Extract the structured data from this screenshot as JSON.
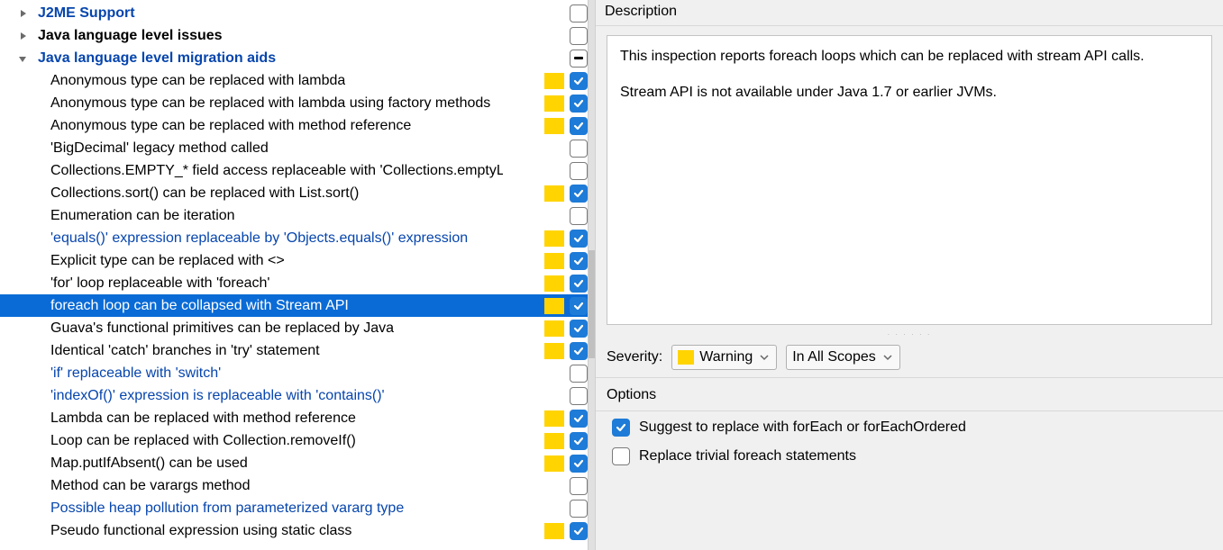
{
  "tree": {
    "groups": [
      {
        "label": "J2ME Support",
        "expanded": false,
        "bold": true,
        "link": true,
        "checkbox": "off"
      },
      {
        "label": "Java language level issues",
        "expanded": false,
        "bold": true,
        "link": false,
        "checkbox": "off"
      },
      {
        "label": "Java language level migration aids",
        "expanded": true,
        "bold": true,
        "link": true,
        "checkbox": "mixed"
      }
    ],
    "items": [
      {
        "label": "Anonymous type can be replaced with lambda",
        "link": false,
        "sev": true,
        "checkbox": "on",
        "selected": false
      },
      {
        "label": "Anonymous type can be replaced with lambda using factory methods",
        "link": false,
        "sev": true,
        "checkbox": "on",
        "selected": false
      },
      {
        "label": "Anonymous type can be replaced with method reference",
        "link": false,
        "sev": true,
        "checkbox": "on",
        "selected": false
      },
      {
        "label": "'BigDecimal' legacy method called",
        "link": false,
        "sev": false,
        "checkbox": "off",
        "selected": false
      },
      {
        "label": "Collections.EMPTY_* field access replaceable with 'Collections.emptyList()'",
        "link": false,
        "sev": false,
        "checkbox": "off",
        "selected": false
      },
      {
        "label": "Collections.sort() can be replaced with List.sort()",
        "link": false,
        "sev": true,
        "checkbox": "on",
        "selected": false
      },
      {
        "label": "Enumeration can be iteration",
        "link": false,
        "sev": false,
        "checkbox": "off",
        "selected": false
      },
      {
        "label": "'equals()' expression replaceable by 'Objects.equals()' expression",
        "link": true,
        "sev": true,
        "checkbox": "on",
        "selected": false
      },
      {
        "label": "Explicit type can be replaced with <>",
        "link": false,
        "sev": true,
        "checkbox": "on",
        "selected": false
      },
      {
        "label": "'for' loop replaceable with 'foreach'",
        "link": false,
        "sev": true,
        "checkbox": "on",
        "selected": false
      },
      {
        "label": "foreach loop can be collapsed with Stream API",
        "link": false,
        "sev": true,
        "checkbox": "on",
        "selected": true
      },
      {
        "label": "Guava's functional primitives can be replaced by Java",
        "link": false,
        "sev": true,
        "checkbox": "on",
        "selected": false
      },
      {
        "label": "Identical 'catch' branches in 'try' statement",
        "link": false,
        "sev": true,
        "checkbox": "on",
        "selected": false
      },
      {
        "label": "'if' replaceable with 'switch'",
        "link": true,
        "sev": false,
        "checkbox": "off",
        "selected": false
      },
      {
        "label": "'indexOf()' expression is replaceable with 'contains()'",
        "link": true,
        "sev": false,
        "checkbox": "off",
        "selected": false
      },
      {
        "label": "Lambda can be replaced with method reference",
        "link": false,
        "sev": true,
        "checkbox": "on",
        "selected": false
      },
      {
        "label": "Loop can be replaced with Collection.removeIf()",
        "link": false,
        "sev": true,
        "checkbox": "on",
        "selected": false
      },
      {
        "label": "Map.putIfAbsent() can be used",
        "link": false,
        "sev": true,
        "checkbox": "on",
        "selected": false
      },
      {
        "label": "Method can be varargs method",
        "link": false,
        "sev": false,
        "checkbox": "off",
        "selected": false
      },
      {
        "label": "Possible heap pollution from parameterized vararg type",
        "link": true,
        "sev": false,
        "checkbox": "off",
        "selected": false
      },
      {
        "label": "Pseudo functional expression using static class",
        "link": false,
        "sev": true,
        "checkbox": "on",
        "selected": false
      }
    ]
  },
  "right": {
    "desc_title": "Description",
    "desc_p1": "This inspection reports foreach loops which can be replaced with stream API calls.",
    "desc_p2": "Stream API is not available under Java 1.7 or earlier JVMs.",
    "severity_label": "Severity:",
    "severity_value": "Warning",
    "scope_value": "In All Scopes",
    "options_title": "Options",
    "opt1": "Suggest to replace with forEach or forEachOrdered",
    "opt2": "Replace trivial foreach statements"
  }
}
